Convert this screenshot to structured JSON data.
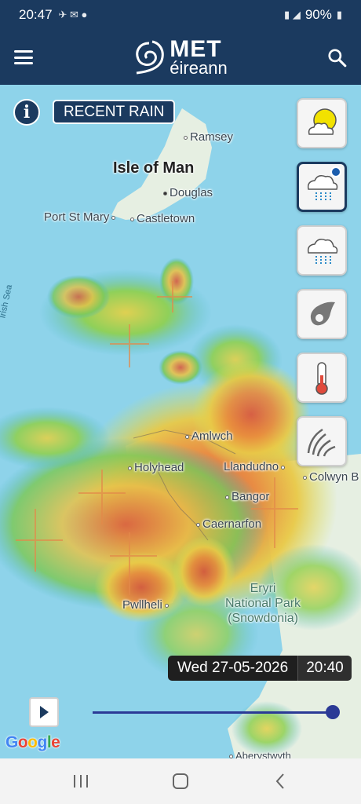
{
  "status": {
    "time": "20:47",
    "battery": "90%"
  },
  "app": {
    "logo_main": "MET",
    "logo_sub": "éireann"
  },
  "map": {
    "layer_label": "RECENT RAIN",
    "places": {
      "ramsey": "Ramsey",
      "isle_of_man": "Isle of Man",
      "douglas": "Douglas",
      "port_st_mary": "Port St Mary",
      "castletown": "Castletown",
      "irish_sea": "Irish Sea",
      "amlwch": "Amlwch",
      "holyhead": "Holyhead",
      "llandudno": "Llandudno",
      "colwyn_bay": "Colwyn B",
      "bangor": "Bangor",
      "caernarfon": "Caernarfon",
      "pwllheli": "Pwllheli",
      "eryri_line1": "Eryri",
      "eryri_line2": "National Park",
      "eryri_line3": "(Snowdonia)",
      "aberystwyth": "Aberystwyth"
    },
    "layers": [
      {
        "name": "forecast",
        "icon": "sun-cloud-icon",
        "active": false
      },
      {
        "name": "recent-rain",
        "icon": "rain-cloud-active-icon",
        "active": true
      },
      {
        "name": "rain",
        "icon": "rain-cloud-icon",
        "active": false
      },
      {
        "name": "wind",
        "icon": "wind-swirl-icon",
        "active": false
      },
      {
        "name": "temperature",
        "icon": "thermometer-icon",
        "active": false
      },
      {
        "name": "pressure",
        "icon": "isobar-icon",
        "active": false
      }
    ],
    "timestamp_date": "Wed 27-05-2026",
    "timestamp_time": "20:40",
    "timeline_progress": 1.0,
    "attribution": "Google"
  },
  "colors": {
    "brand": "#1b3a5f",
    "sea": "#8ed3ea",
    "land": "#e7efe3",
    "slider": "#2b3a96"
  }
}
